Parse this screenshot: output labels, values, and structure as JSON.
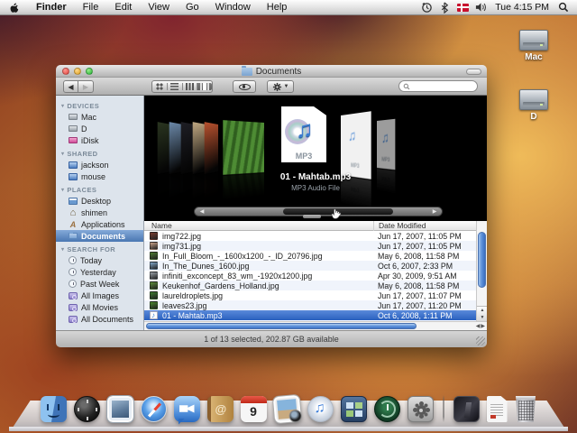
{
  "menu_bar": {
    "menus": [
      "Finder",
      "File",
      "Edit",
      "View",
      "Go",
      "Window",
      "Help"
    ],
    "app_menu": "Finder",
    "status_icons": [
      "time-machine-menu-icon",
      "bluetooth-icon",
      "input-language-flag-icon",
      "volume-icon",
      "spotlight-icon"
    ],
    "clock": "Tue 4:15 PM"
  },
  "desktop": {
    "icons": [
      {
        "label": "Mac"
      },
      {
        "label": "D"
      }
    ]
  },
  "window": {
    "title": "Documents",
    "toolbar": {
      "search_value": "",
      "view_modes": [
        "icon-view",
        "list-view",
        "column-view",
        "coverflow-view"
      ],
      "active_view": "coverflow-view"
    },
    "sidebar": {
      "sections": [
        {
          "title": "DEVICES",
          "items": [
            {
              "label": "Mac",
              "icon": "si-hd"
            },
            {
              "label": "D",
              "icon": "si-hd"
            },
            {
              "label": "iDisk",
              "icon": "si-idisk"
            }
          ]
        },
        {
          "title": "SHARED",
          "items": [
            {
              "label": "jackson",
              "icon": "si-mon"
            },
            {
              "label": "mouse",
              "icon": "si-mon"
            }
          ]
        },
        {
          "title": "PLACES",
          "items": [
            {
              "label": "Desktop",
              "icon": "si-desk"
            },
            {
              "label": "shimen",
              "icon": "si-home",
              "glyph": "⌂"
            },
            {
              "label": "Applications",
              "icon": "si-apps",
              "glyph": "A"
            },
            {
              "label": "Documents",
              "icon": "si-folder",
              "selected": true
            }
          ]
        },
        {
          "title": "SEARCH FOR",
          "items": [
            {
              "label": "Today",
              "icon": "si-clock"
            },
            {
              "label": "Yesterday",
              "icon": "si-clock"
            },
            {
              "label": "Past Week",
              "icon": "si-clock"
            },
            {
              "label": "All Images",
              "icon": "si-smart"
            },
            {
              "label": "All Movies",
              "icon": "si-smart"
            },
            {
              "label": "All Documents",
              "icon": "si-smart"
            }
          ]
        }
      ]
    },
    "coverflow": {
      "selected_title": "01 - Mahtab.mp3",
      "selected_subtitle": "MP3 Audio File",
      "badge": "MP3",
      "left_covers": [
        "#2a3520",
        "#6b88a8",
        "#1e1e24",
        "#c0a882",
        "#b8512e"
      ],
      "front_cover": "#4e8c34",
      "right_mp3_covers": 2
    },
    "list": {
      "columns": [
        "Name",
        "Date Modified"
      ],
      "rows": [
        {
          "name": "img722.jpg",
          "date": "Jun 17, 2007, 11:05 PM",
          "color": "#7a3b2e"
        },
        {
          "name": "img731.jpg",
          "date": "Jun 17, 2007, 11:05 PM",
          "color": "#c9a188"
        },
        {
          "name": "In_Full_Bloom_-_1600x1200_-_ID_20796.jpg",
          "date": "May 6, 2008, 11:58 PM",
          "color": "#4e7d32"
        },
        {
          "name": "In_The_Dunes_1600.jpg",
          "date": "Oct 6, 2007, 2:33 PM",
          "color": "#7fa6c9"
        },
        {
          "name": "infiniti_exconcept_83_wm_-1920x1200.jpg",
          "date": "Apr 30, 2009, 9:51 AM",
          "color": "#9aa0a6"
        },
        {
          "name": "Keukenhof_Gardens_Holland.jpg",
          "date": "May 6, 2008, 11:58 PM",
          "color": "#5d8f3a"
        },
        {
          "name": "laureldroplets.jpg",
          "date": "Jun 17, 2007, 11:07 PM",
          "color": "#3f7d2f"
        },
        {
          "name": "leaves23.jpg",
          "date": "Jun 17, 2007, 11:20 PM",
          "color": "#4c8a2e"
        },
        {
          "name": "01 - Mahtab.mp3",
          "date": "Oct 6, 2008, 1:11 PM",
          "mp3": true,
          "selected": true
        }
      ]
    },
    "status_bar": {
      "text": "1 of 13 selected, 202.87 GB available"
    }
  },
  "dock": {
    "items": [
      {
        "name": "finder"
      },
      {
        "name": "dashboard"
      },
      {
        "name": "mail"
      },
      {
        "name": "safari"
      },
      {
        "name": "ichat"
      },
      {
        "name": "address-book"
      },
      {
        "name": "ical"
      },
      {
        "name": "iphoto"
      },
      {
        "name": "itunes"
      },
      {
        "name": "spaces"
      },
      {
        "name": "time-machine"
      },
      {
        "name": "system-preferences"
      },
      {
        "name": "separator"
      },
      {
        "name": "stack"
      },
      {
        "name": "document"
      },
      {
        "name": "trash"
      }
    ],
    "ical_day": "9"
  },
  "colors": {
    "selection_blue": "#3875d7",
    "sidebar_bg": "#dde4ec",
    "coverflow_bg": "#000000",
    "flag_red": "#c8102e"
  }
}
